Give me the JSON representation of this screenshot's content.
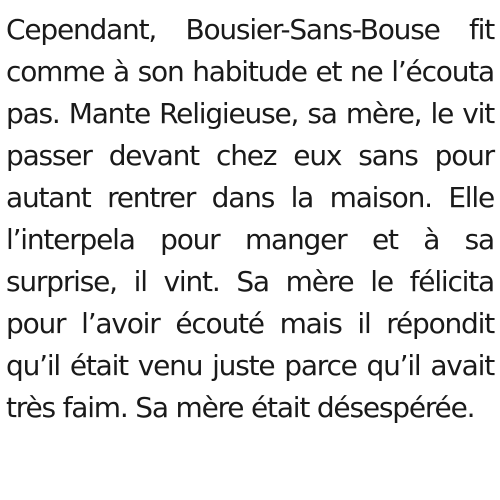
{
  "document": {
    "lines": [
      "Cependant, Bousier-Sans-Bouse fit",
      "comme à son habitude et ne l’écouta",
      "pas. Mante Religieuse, sa mère, le vit",
      "passer devant chez eux sans pour",
      "autant rentrer dans la maison. Elle",
      "l’interpela pour manger et à sa",
      "surprise, il vint. Sa mère le félicita",
      "pour l’avoir écouté mais il répondit",
      "qu’il était venu juste parce qu’il avait",
      "très faim. Sa mère était désespérée."
    ]
  }
}
